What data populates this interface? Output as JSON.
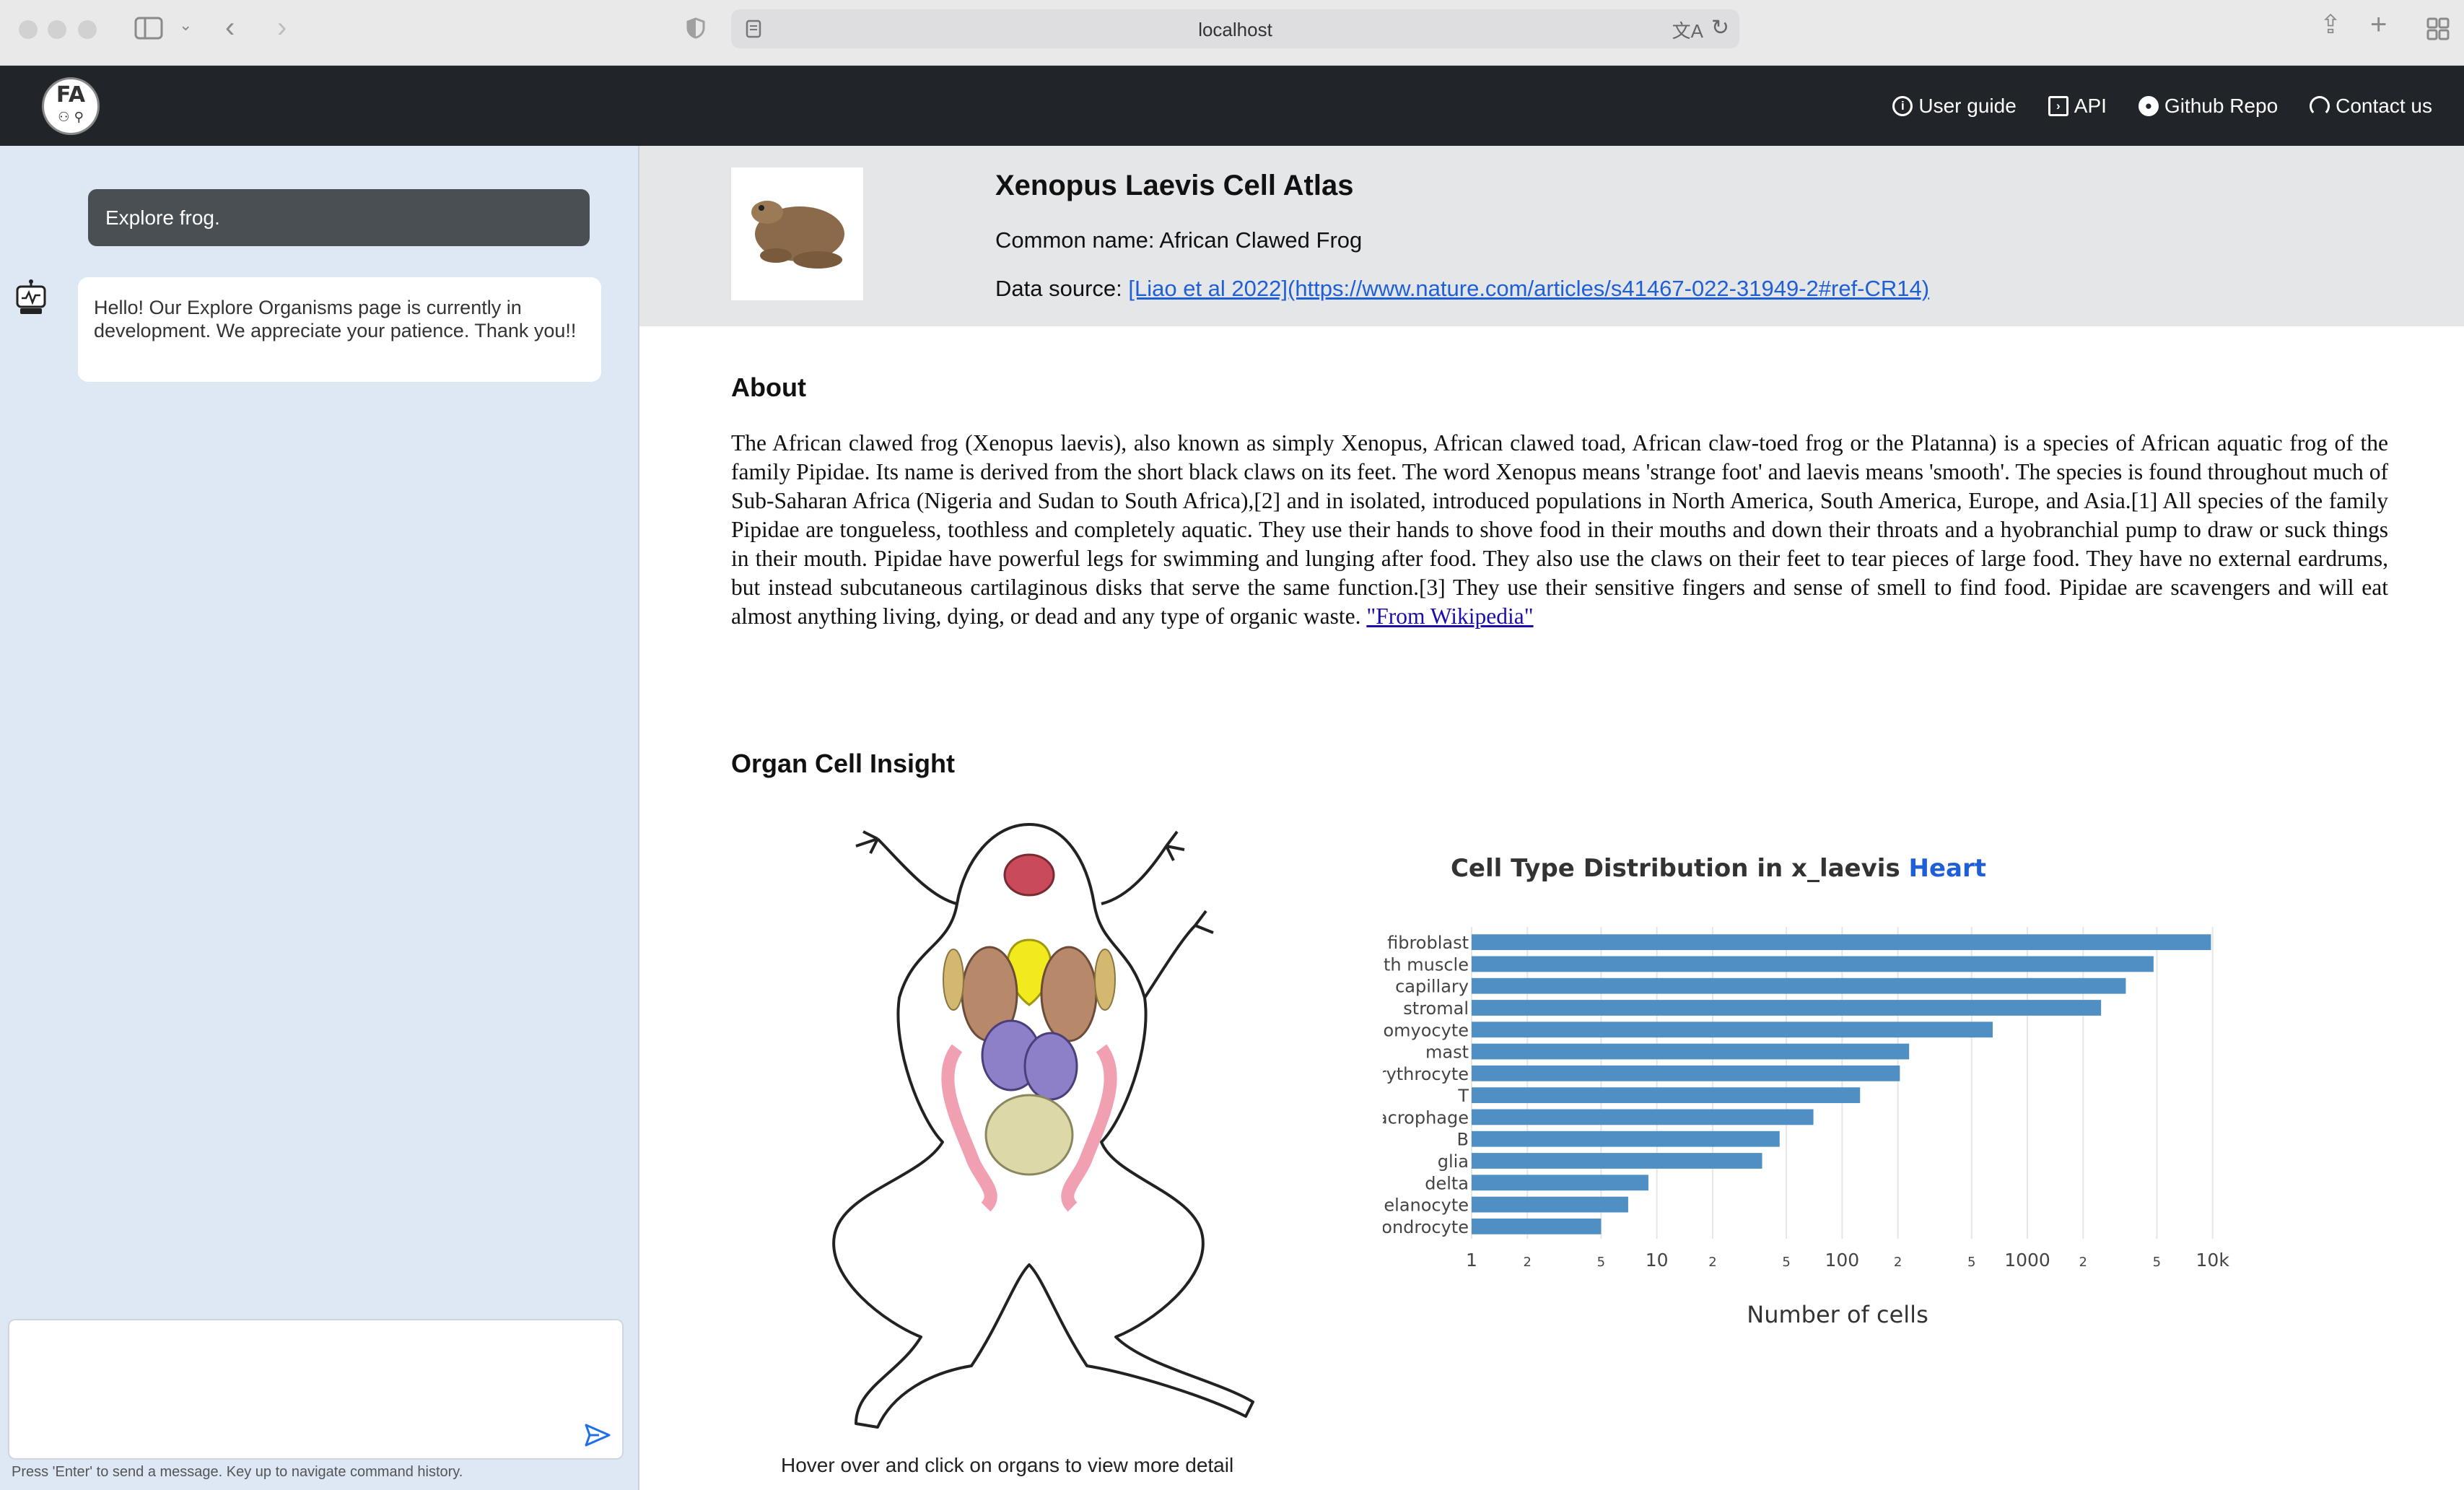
{
  "browser": {
    "url": "localhost"
  },
  "nav": {
    "logo_text": "FA",
    "links": [
      "User guide",
      "API",
      "Github Repo",
      "Contact us"
    ]
  },
  "chat": {
    "user_message": "Explore frog.",
    "bot_message": "Hello! Our Explore Organisms page is currently in development. We appreciate your patience. Thank you!!",
    "input_value": "",
    "hint": "Press 'Enter' to send a message. Key up to navigate command history."
  },
  "header": {
    "title": "Xenopus Laevis Cell Atlas",
    "common_name": "Common name: African Clawed Frog",
    "source_label": "Data source: ",
    "source_link": "[Liao et al 2022](https://www.nature.com/articles/s41467-022-31949-2#ref-CR14)"
  },
  "about": {
    "heading": "About",
    "text": "The African clawed frog (Xenopus laevis), also known as simply Xenopus, African clawed toad, African claw-toed frog or the Platanna) is a species of African aquatic frog of the family Pipidae. Its name is derived from the short black claws on its feet. The word Xenopus means 'strange foot' and laevis means 'smooth'. The species is found throughout much of Sub-Saharan Africa (Nigeria and Sudan to South Africa),[2] and in isolated, introduced populations in North America, South America, Europe, and Asia.[1] All species of the family Pipidae are tongueless, toothless and completely aquatic. They use their hands to shove food in their mouths and down their throats and a hyobranchial pump to draw or suck things in their mouth. Pipidae have powerful legs for swimming and lunging after food. They also use the claws on their feet to tear pieces of large food. They have no external eardrums, but instead subcutaneous cartilaginous disks that serve the same function.[3] They use their sensitive fingers and sense of smell to find food. Pipidae are scavengers and will eat almost anything living, dying, or dead and any type of organic waste.",
    "link": "\"From Wikipedia\""
  },
  "organ": {
    "heading": "Organ Cell Insight",
    "caption": "Hover over and click on organs to view more detail"
  },
  "colors": {
    "bar": "#4f8fc4",
    "accent": "#1f5fd6",
    "nav_bg": "#212529",
    "chat_bg": "#dde8f4"
  },
  "chart_data": {
    "type": "bar",
    "orientation": "horizontal",
    "title_prefix": "Cell Type Distribution in x_laevis ",
    "title_highlight": "Heart",
    "xlabel": "Number of cells",
    "ylabel": "",
    "xscale": "log",
    "xlim": [
      1,
      12000
    ],
    "grid": true,
    "x_ticks": [
      "1",
      "2",
      "5",
      "10",
      "2",
      "5",
      "100",
      "2",
      "5",
      "1000",
      "2",
      "5",
      "10k"
    ],
    "x_tick_values": [
      1,
      2,
      5,
      10,
      20,
      50,
      100,
      200,
      500,
      1000,
      2000,
      5000,
      10000
    ],
    "categories": [
      "fibroblast",
      "smooth muscle",
      "capillary",
      "stromal",
      "cardiomyocyte",
      "mast",
      "erythrocyte",
      "T",
      "macrophage",
      "B",
      "glia",
      "delta",
      "melanocyte",
      "chondrocyte"
    ],
    "values": [
      9800,
      4800,
      3400,
      2500,
      650,
      230,
      205,
      125,
      70,
      46,
      37,
      9,
      7,
      5
    ]
  }
}
